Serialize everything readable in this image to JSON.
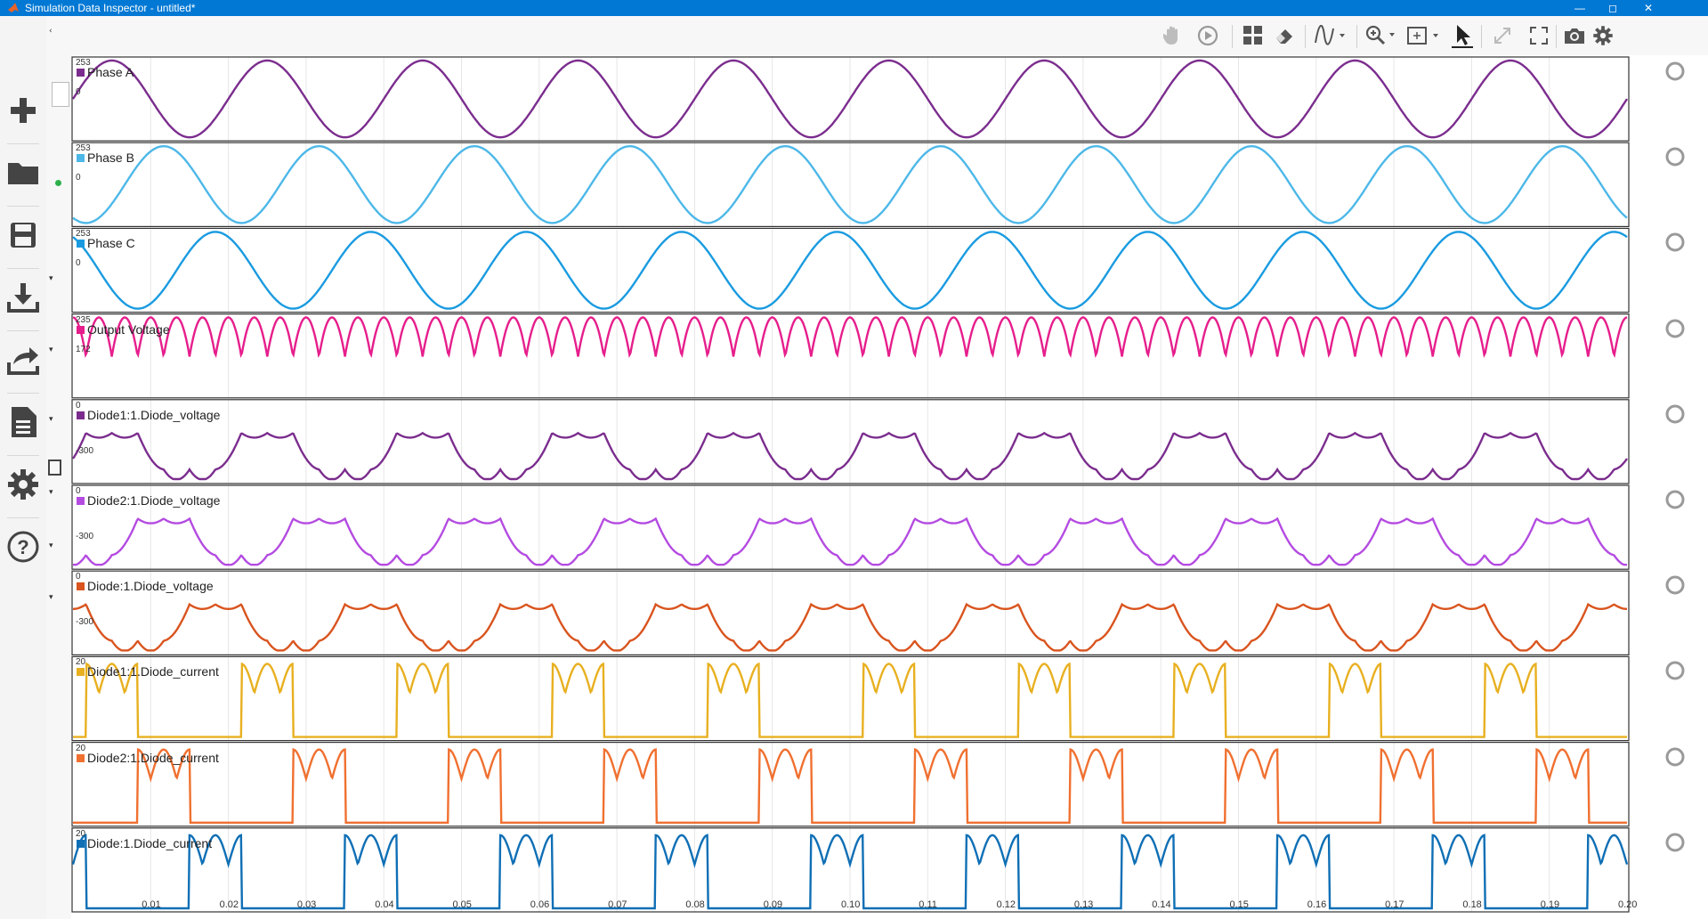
{
  "window": {
    "title": "Simulation Data Inspector - untitled*"
  },
  "left_toolbar": {
    "icons": [
      "add-icon",
      "folder-open-icon",
      "save-icon",
      "download-icon",
      "share-icon",
      "report-icon",
      "settings-icon",
      "help-icon"
    ]
  },
  "top_toolbar": {
    "icons": [
      "pan-hand-icon",
      "replay-icon",
      "layout-grid-icon",
      "eraser-icon",
      "signal-style-icon",
      "zoom-in-icon",
      "fit-to-view-icon",
      "select-cursor-icon",
      "expand-icon",
      "fullscreen-icon",
      "snapshot-camera-icon",
      "settings-icon"
    ]
  },
  "colors": {
    "phase_a": "#7b2d8e",
    "phase_b": "#4db8e8",
    "phase_c": "#1a9be0",
    "output_voltage": "#e61e8c",
    "diode1_voltage": "#7b2d8e",
    "diode2_voltage": "#b44be1",
    "diode_voltage": "#d9541e",
    "diode1_current": "#e8b020",
    "diode2_current": "#f07030",
    "diode_current": "#0f6fb5",
    "accent": "#0078d4"
  },
  "plots": [
    {
      "name": "Phase A",
      "y_labels": [
        "253",
        "0"
      ],
      "ylim": [
        -253,
        253
      ]
    },
    {
      "name": "Phase B",
      "y_labels": [
        "253",
        "0"
      ],
      "ylim": [
        -253,
        253
      ]
    },
    {
      "name": "Phase C",
      "y_labels": [
        "253",
        "0"
      ],
      "ylim": [
        -253,
        253
      ]
    },
    {
      "name": "Output Voltage",
      "y_labels": [
        "235",
        "172"
      ],
      "ylim": [
        120,
        235
      ]
    },
    {
      "name": "Diode1:1.Diode_voltage",
      "y_labels": [
        "0",
        "-300"
      ],
      "ylim": [
        -440,
        0
      ]
    },
    {
      "name": "Diode2:1.Diode_voltage",
      "y_labels": [
        "0",
        "-300"
      ],
      "ylim": [
        -440,
        0
      ]
    },
    {
      "name": "Diode:1.Diode_voltage",
      "y_labels": [
        "0",
        "-300"
      ],
      "ylim": [
        -440,
        0
      ]
    },
    {
      "name": "Diode1:1.Diode_current",
      "y_labels": [
        "20"
      ],
      "ylim": [
        0,
        21
      ]
    },
    {
      "name": "Diode2:1.Diode_current",
      "y_labels": [
        "20"
      ],
      "ylim": [
        0,
        21
      ]
    },
    {
      "name": "Diode:1.Diode_current",
      "y_labels": [
        "20"
      ],
      "ylim": [
        0,
        21
      ]
    }
  ],
  "x_axis": {
    "ticks": [
      "0.01",
      "0.02",
      "0.03",
      "0.04",
      "0.05",
      "0.06",
      "0.07",
      "0.08",
      "0.09",
      "0.10",
      "0.11",
      "0.12",
      "0.13",
      "0.14",
      "0.15",
      "0.16",
      "0.17",
      "0.18",
      "0.19",
      "0.20"
    ],
    "range": [
      0,
      0.2
    ]
  },
  "chart_data": {
    "type": "line",
    "x_range": [
      0,
      0.2
    ],
    "series": [
      {
        "name": "Phase A",
        "waveform": "sine",
        "amplitude": 253,
        "frequency_hz": 50,
        "phase_deg": 0
      },
      {
        "name": "Phase B",
        "waveform": "sine",
        "amplitude": 253,
        "frequency_hz": 50,
        "phase_deg": -120
      },
      {
        "name": "Phase C",
        "waveform": "sine",
        "amplitude": 253,
        "frequency_hz": 50,
        "phase_deg": 120
      },
      {
        "name": "Output Voltage",
        "waveform": "six-pulse-rectified",
        "max": 235,
        "min": 125
      },
      {
        "name": "Diode1:1.Diode_voltage",
        "max": 0,
        "min": -435
      },
      {
        "name": "Diode2:1.Diode_voltage",
        "max": 0,
        "min": -435
      },
      {
        "name": "Diode:1.Diode_voltage",
        "max": 0,
        "min": -435
      },
      {
        "name": "Diode1:1.Diode_current",
        "max": 20,
        "min": 0
      },
      {
        "name": "Diode2:1.Diode_current",
        "max": 20,
        "min": 0
      },
      {
        "name": "Diode:1.Diode_current",
        "max": 20,
        "min": 0
      }
    ]
  }
}
